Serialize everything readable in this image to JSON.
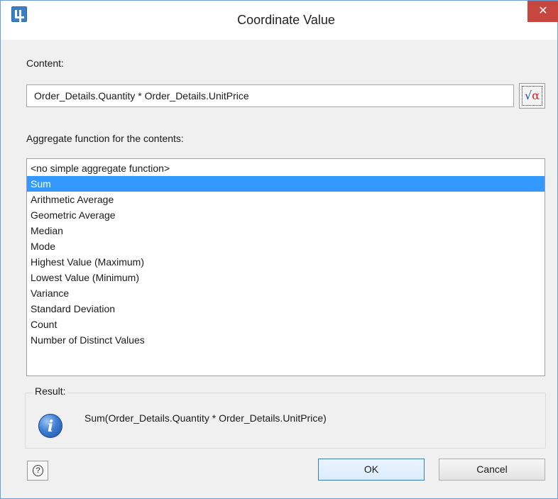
{
  "window": {
    "title": "Coordinate Value",
    "close_symbol": "✕"
  },
  "content": {
    "label": "Content:",
    "value": "Order_Details.Quantity * Order_Details.UnitPrice",
    "formula_button_icon": "formula-editor-icon",
    "formula_glyph": "√",
    "formula_alpha": "α"
  },
  "aggregate": {
    "label": "Aggregate function for the contents:",
    "items": [
      "<no simple aggregate function>",
      "Sum",
      "Arithmetic Average",
      "Geometric Average",
      "Median",
      "Mode",
      "Highest Value (Maximum)",
      "Lowest Value (Minimum)",
      "Variance",
      "Standard Deviation",
      "Count",
      "Number of Distinct Values"
    ],
    "selected_index": 1
  },
  "result": {
    "label": "Result:",
    "icon": "info-icon",
    "icon_glyph": "i",
    "text": "Sum(Order_Details.Quantity * Order_Details.UnitPrice)"
  },
  "buttons": {
    "help_icon": "help-icon",
    "help_glyph": "?",
    "ok": "OK",
    "cancel": "Cancel"
  },
  "colors": {
    "selection": "#3399ff",
    "close": "#c7463f",
    "border_accent": "#6d9fd6"
  }
}
